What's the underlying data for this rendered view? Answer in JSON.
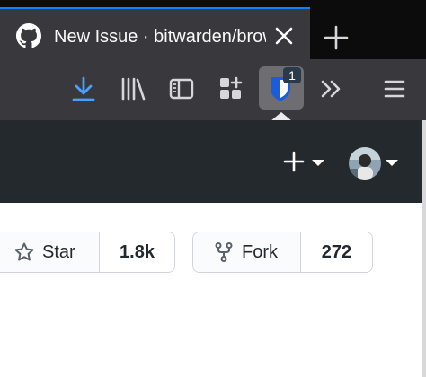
{
  "browser": {
    "active_tab": {
      "title": "New Issue · bitwarden/browser",
      "favicon": "github-icon"
    },
    "accent_color": "#0a84ff",
    "new_tab_icon": "plus-icon"
  },
  "toolbar": {
    "icons": [
      "download-icon",
      "library-icon",
      "sidebar-icon",
      "extensions-icon",
      "bitwarden-shield-icon",
      "overflow-chevrons-icon",
      "hamburger-menu-icon"
    ],
    "bitwarden_badge": "1"
  },
  "github_header": {
    "background": "#24292e",
    "create_icon": "plus-icon",
    "avatar": "user-avatar"
  },
  "repo_actions": {
    "star": {
      "label": "Star",
      "count": "1.8k"
    },
    "fork": {
      "label": "Fork",
      "count": "272"
    }
  }
}
